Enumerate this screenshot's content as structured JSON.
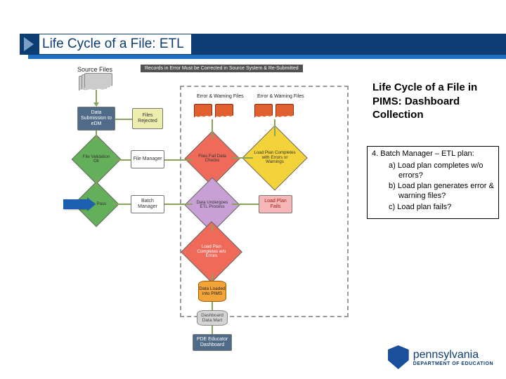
{
  "slide": {
    "title": "Life Cycle of a File: ETL"
  },
  "right": {
    "heading": "Life Cycle of a File in PIMS: Dashboard Collection",
    "note_title": "4. Batch Manager – ETL plan:",
    "note_a": "a) Load plan completes w/o errors?",
    "note_b": "b) Load plan generates error & warning files?",
    "note_c": "c) Load plan fails?"
  },
  "flow": {
    "source_files_label": "Source Files",
    "banner": "Records in Error Must be Corrected in Source System & Re-Submitted",
    "data_submission": "Data Submission to eDM",
    "files_rejected": "Files Rejected",
    "err_warn_files1": "Error & Warning Files",
    "err_warn_files2": "Error & Warning Files",
    "file_validation_ok": "File Validation Ok",
    "file_manager": "File Manager",
    "files_fail_data_checks": "Files Fail Data Checks",
    "load_plan_completes_errwarn": "Load Plan Completes with Errors or Warnings",
    "files_pass": "Files Pass",
    "batch_manager": "Batch Manager",
    "data_undergoes_etl": "Data Undergoes ETL Process",
    "load_plan_fails": "Load Plan Fails",
    "load_plan_completes_noerr": "Load Plan Completes w/o Errors",
    "data_loaded_pims": "Data Loaded into PIMS",
    "dashboard_data_mart": "Dashboard Data Mart",
    "pde_educator_dashboard": "PDE Educator Dashboard"
  },
  "logo": {
    "wordmark": "pennsylvania",
    "subline": "DEPARTMENT OF EDUCATION"
  }
}
